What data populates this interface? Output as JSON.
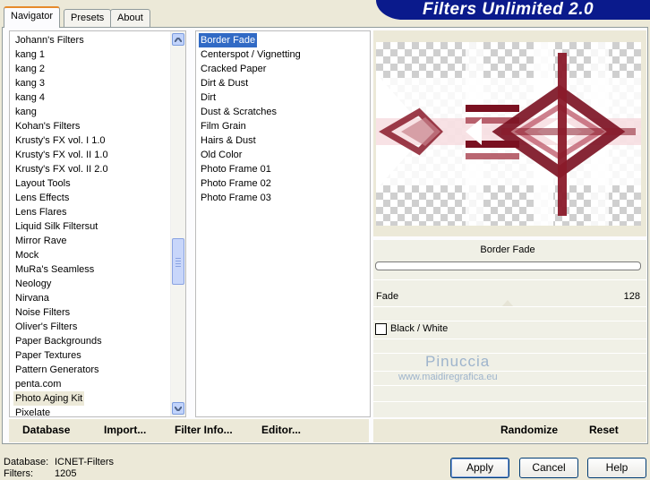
{
  "banner": {
    "title": "Filters Unlimited 2.0"
  },
  "tabs": [
    {
      "label": "Navigator",
      "active": true
    },
    {
      "label": "Presets",
      "active": false
    },
    {
      "label": "About",
      "active": false
    }
  ],
  "categories": {
    "items": [
      "Johann's Filters",
      "kang 1",
      "kang 2",
      "kang 3",
      "kang 4",
      "kang",
      "Kohan's Filters",
      "Krusty's FX vol. I 1.0",
      "Krusty's FX vol. II 1.0",
      "Krusty's FX vol. II 2.0",
      "Layout Tools",
      "Lens Effects",
      "Lens Flares",
      "Liquid Silk Filtersut",
      "Mirror Rave",
      "Mock",
      "MuRa's Seamless",
      "Neology",
      "Nirvana",
      "Noise Filters",
      "Oliver's Filters",
      "Paper Backgrounds",
      "Paper Textures",
      "Pattern Generators",
      "penta.com",
      "Photo Aging Kit",
      "Pixelate"
    ],
    "selected": "Photo Aging Kit",
    "scroll_position": 0.62
  },
  "filters": {
    "items": [
      "Border Fade",
      "Centerspot / Vignetting",
      "Cracked Paper",
      "Dirt & Dust",
      "Dirt",
      "Dust & Scratches",
      "Film Grain",
      "Hairs & Dust",
      "Old Color",
      "Photo Frame 01",
      "Photo Frame 02",
      "Photo Frame 03"
    ],
    "selected": "Border Fade"
  },
  "left_bar": {
    "database": "Database",
    "import": "Import...",
    "filter_info": "Filter Info...",
    "editor": "Editor..."
  },
  "preview": {
    "filter_name": "Border Fade",
    "fade_label": "Fade",
    "fade_value": "128",
    "fade_fraction": 0.5,
    "checkbox_label": "Black / White",
    "checkbox_checked": false,
    "watermark_name": "Pinuccia",
    "watermark_url": "www.maidiregrafica.eu",
    "accent": "#7a1020"
  },
  "right_bar": {
    "randomize": "Randomize",
    "reset": "Reset"
  },
  "status": {
    "database_label": "Database:",
    "database_value": "ICNET-Filters",
    "filters_label": "Filters:",
    "filters_value": "1205"
  },
  "dialog_buttons": {
    "apply": "Apply",
    "cancel": "Cancel",
    "help": "Help"
  }
}
